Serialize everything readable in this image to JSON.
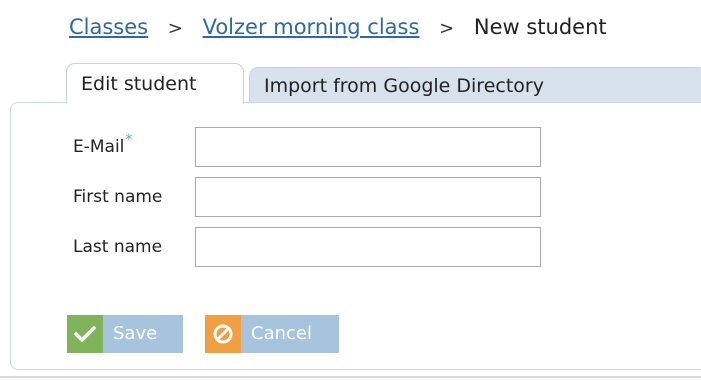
{
  "breadcrumb": {
    "items": [
      {
        "label": "Classes"
      },
      {
        "label": "Volzer morning class"
      },
      {
        "label": "New student"
      }
    ],
    "separator": ">"
  },
  "tabs": [
    {
      "label": "Edit student",
      "active": true
    },
    {
      "label": "Import from Google Directory",
      "active": false
    }
  ],
  "form": {
    "email": {
      "label": "E-Mail",
      "required_mark": "*",
      "value": ""
    },
    "first_name": {
      "label": "First name",
      "value": ""
    },
    "last_name": {
      "label": "Last name",
      "value": ""
    }
  },
  "buttons": {
    "save": {
      "label": "Save",
      "icon": "checkmark-icon",
      "icon_color": "#7fb45a"
    },
    "cancel": {
      "label": "Cancel",
      "icon": "cancel-icon",
      "icon_color": "#f0a040"
    },
    "background_color": "#a6c4de"
  },
  "colors": {
    "link": "#2b6aa6",
    "required": "#4aa3e8",
    "inactive_tab": "#d7e2ec"
  }
}
